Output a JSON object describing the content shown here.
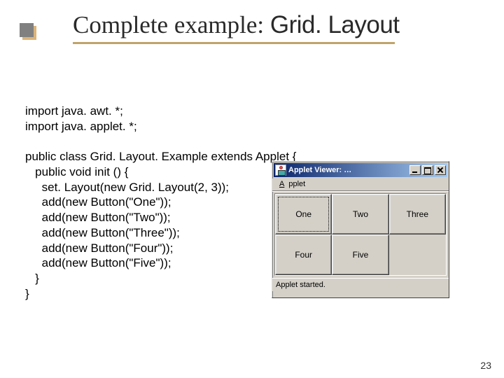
{
  "slide": {
    "title_prefix": "Complete example: ",
    "title_bold": "Grid. Layout",
    "page_number": "23"
  },
  "code": {
    "lines": [
      "import java. awt. *;",
      "import java. applet. *;",
      "",
      "public class Grid. Layout. Example extends Applet {",
      "   public void init () {",
      "     set. Layout(new Grid. Layout(2, 3));",
      "     add(new Button(\"One\"));",
      "     add(new Button(\"Two\"));",
      "     add(new Button(\"Three\"));",
      "     add(new Button(\"Four\"));",
      "     add(new Button(\"Five\"));",
      "   }",
      "}"
    ]
  },
  "applet": {
    "window_title": "Applet Viewer: …",
    "menu_item": "Applet",
    "status": "Applet started.",
    "buttons": [
      "One",
      "Two",
      "Three",
      "Four",
      "Five"
    ]
  }
}
